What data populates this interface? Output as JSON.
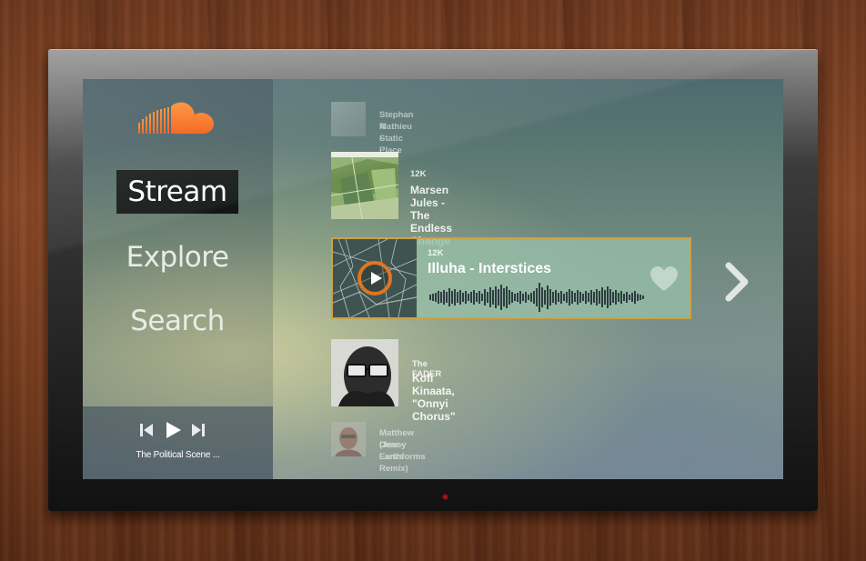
{
  "nav": {
    "stream": "Stream",
    "explore": "Explore",
    "search": "Search"
  },
  "player": {
    "now_playing": "The Political Scene ..."
  },
  "tracks": [
    {
      "source": "Stephan Mathieu -",
      "title": "A Static Place"
    },
    {
      "source": "12K",
      "title": "Marsen Jules - The Endless Change"
    },
    {
      "source": "12K",
      "title": "Illuha - Interstices"
    },
    {
      "source": "The FADER",
      "title": "Kofi Kinaata, \"Onnyi Chorus\""
    },
    {
      "source": "Matthew Dear - Earthforms",
      "title": "(Jessy Lanza Remix)"
    }
  ],
  "colors": {
    "brand_orange": "#f26f21",
    "featured_border": "#c9a24a",
    "play_ring": "#e0761f",
    "active_nav_bg": "#121614"
  },
  "icons": {
    "logo": "soundcloud-cloud-icon",
    "prev": "skip-previous-icon",
    "play": "play-icon",
    "next": "skip-next-icon",
    "heart": "heart-icon",
    "chevron": "chevron-right-icon"
  }
}
